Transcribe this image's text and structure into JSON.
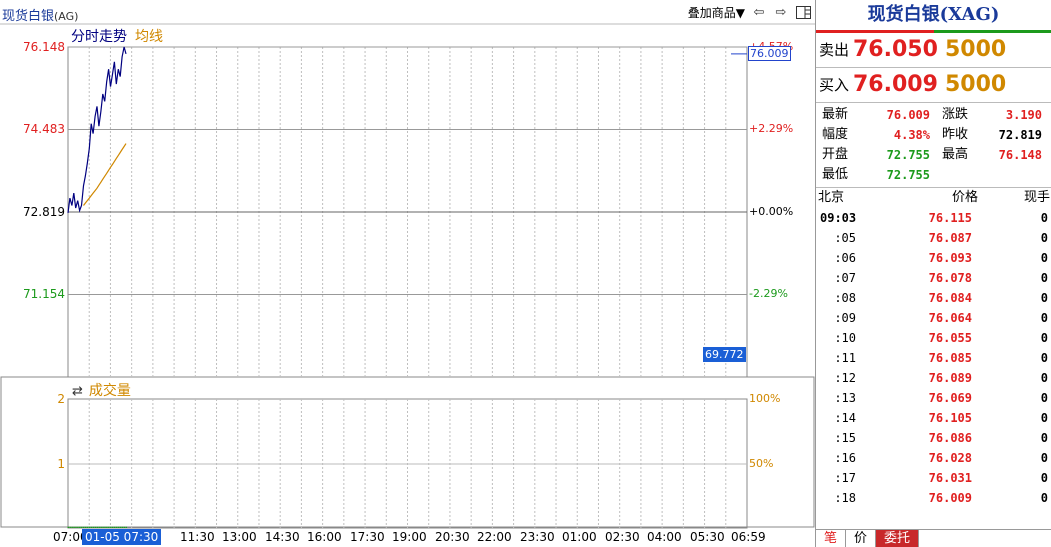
{
  "header": {
    "title": "现货白银",
    "code": "(AG)",
    "overlay_label": "叠加商品"
  },
  "icons": {
    "overlay": "dropdown-arrow-icon",
    "prev": "arrow-left-icon",
    "next": "arrow-right-icon",
    "layout": "window-layout-icon",
    "swap": "swap-arrows-icon"
  },
  "colors": {
    "price_line": "#000080",
    "avg_line": "#d08800",
    "up": "#e02020",
    "down": "#1c9a1c",
    "highlight": "#1a5fd6"
  },
  "main_chart": {
    "legend_price": "分时走势",
    "legend_avg": "均线",
    "y_left_labels": [
      "76.148",
      "74.483",
      "72.819",
      "71.154"
    ],
    "y_right_labels": [
      "+4.57%",
      "+2.29%",
      "+0.00%",
      "-2.29%"
    ],
    "current_value": "76.009",
    "low_value": "69.772"
  },
  "volume_chart": {
    "legend": "成交量",
    "y_left_labels": [
      "2",
      "1"
    ],
    "y_right_labels": [
      "100%",
      "50%"
    ]
  },
  "x_axis": {
    "selected": "01-05 07:30",
    "labels": [
      "07:00",
      "11:30",
      "13:00",
      "14:30",
      "16:00",
      "17:30",
      "19:00",
      "20:30",
      "22:00",
      "23:30",
      "01:00",
      "02:30",
      "04:00",
      "05:30",
      "06:59"
    ]
  },
  "chart_data": {
    "type": "line",
    "title": "",
    "ylim": [
      69.49,
      76.148
    ],
    "y_ticks": [
      76.148,
      74.483,
      72.819,
      71.154
    ],
    "pct_ticks": [
      "+4.57%",
      "+2.29%",
      "+0.00%",
      "-2.29%"
    ],
    "prev_close": 72.819,
    "series": [
      {
        "name": "分时走势",
        "values": [
          72.8,
          73.1,
          72.95,
          73.2,
          72.9,
          73.05,
          72.85,
          72.95,
          73.35,
          73.55,
          73.8,
          74.1,
          74.6,
          74.4,
          74.75,
          74.95,
          74.55,
          74.85,
          75.2,
          75.05,
          75.45,
          75.7,
          75.35,
          75.6,
          75.85,
          75.4,
          75.7,
          75.55,
          75.95,
          76.148,
          76.009
        ]
      },
      {
        "name": "均线",
        "values": [
          null,
          null,
          null,
          null,
          null,
          null,
          null,
          null,
          72.95,
          73.0,
          73.05,
          73.1,
          73.15,
          73.2,
          73.25,
          73.3,
          73.36,
          73.42,
          73.48,
          73.54,
          73.6,
          73.66,
          73.72,
          73.78,
          73.84,
          73.9,
          73.96,
          74.02,
          74.08,
          74.14,
          74.2
        ]
      }
    ],
    "volume": {
      "ylim": [
        0,
        2
      ],
      "values": [
        0.02,
        0.02,
        0.02,
        0.02,
        0.02,
        0.02,
        0.02,
        0.02,
        0.02,
        0.02,
        0.02,
        0.02,
        0.02,
        0.02,
        0.02,
        0.02,
        0.02,
        0.02,
        0.02,
        0.02,
        0.02,
        0.02,
        0.02,
        0.02,
        0.02,
        0.02,
        0.02,
        0.02,
        0.02,
        0.02,
        0.02
      ]
    }
  },
  "quote": {
    "title": "现货白银(XAG)",
    "sell_label": "卖出",
    "sell_price": "76.050",
    "sell_vol": "5000",
    "buy_label": "买入",
    "buy_price": "76.009",
    "buy_vol": "5000",
    "stats": [
      {
        "k": "最新",
        "v": "76.009",
        "vc": "red",
        "k2": "涨跌",
        "v2": "3.190",
        "v2c": "red"
      },
      {
        "k": "幅度",
        "v": "4.38%",
        "vc": "red",
        "k2": "昨收",
        "v2": "72.819",
        "v2c": "blk"
      },
      {
        "k": "开盘",
        "v": "72.755",
        "vc": "green",
        "k2": "最高",
        "v2": "76.148",
        "v2c": "red"
      },
      {
        "k": "最低",
        "v": "72.755",
        "vc": "green",
        "k2": "",
        "v2": "",
        "v2c": "blk"
      }
    ],
    "tick_headers": [
      "北京",
      "价格",
      "现手"
    ],
    "ticks": [
      {
        "t": "09:03",
        "p": "76.115",
        "v": "0"
      },
      {
        "t": ":05",
        "p": "76.087",
        "v": "0"
      },
      {
        "t": ":06",
        "p": "76.093",
        "v": "0"
      },
      {
        "t": ":07",
        "p": "76.078",
        "v": "0"
      },
      {
        "t": ":08",
        "p": "76.084",
        "v": "0"
      },
      {
        "t": ":09",
        "p": "76.064",
        "v": "0"
      },
      {
        "t": ":10",
        "p": "76.055",
        "v": "0"
      },
      {
        "t": ":11",
        "p": "76.085",
        "v": "0"
      },
      {
        "t": ":12",
        "p": "76.089",
        "v": "0"
      },
      {
        "t": ":13",
        "p": "76.069",
        "v": "0"
      },
      {
        "t": ":14",
        "p": "76.105",
        "v": "0"
      },
      {
        "t": ":15",
        "p": "76.086",
        "v": "0"
      },
      {
        "t": ":16",
        "p": "76.028",
        "v": "0"
      },
      {
        "t": ":17",
        "p": "76.031",
        "v": "0"
      },
      {
        "t": ":18",
        "p": "76.009",
        "v": "0"
      }
    ],
    "tabs": [
      "笔",
      "价",
      "委托"
    ]
  }
}
